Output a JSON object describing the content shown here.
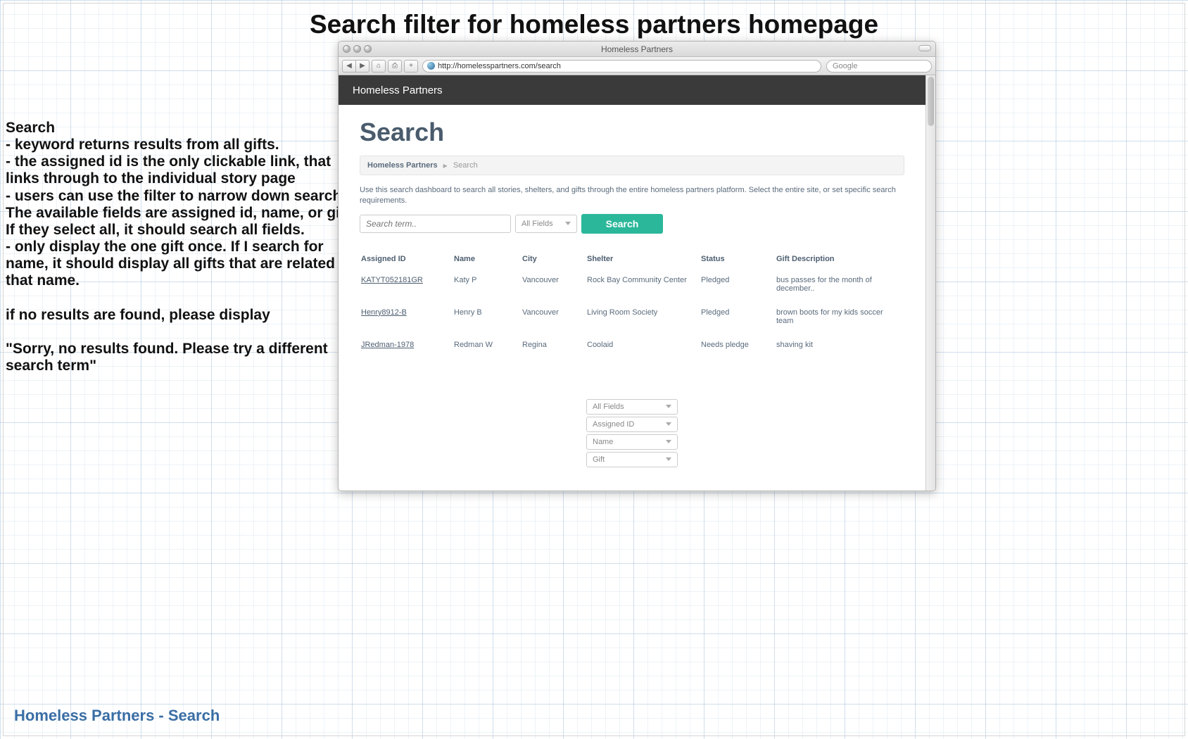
{
  "page_title": "Search filter for homeless partners homepage",
  "annotation": {
    "heading": "Search",
    "lines": [
      "- keyword returns results from all gifts.",
      "- the assigned id is the only clickable link, that links through to the individual story page",
      "- users can use the filter to narrow down search. The available fields are assigned id, name, or gift. If they select all, it should search all fields.",
      "- only display the one gift once. If I search for name, it should display all gifts that are related to that name."
    ],
    "no_results_intro": "if no results are found, please display",
    "no_results_msg": "\"Sorry, no results found. Please try a different search term\""
  },
  "footer_label": "Homeless Partners - Search",
  "browser": {
    "title": "Homeless Partners",
    "url": "http://homelesspartners.com/search",
    "search_placeholder": "Google"
  },
  "app": {
    "brand": "Homeless Partners",
    "heading": "Search",
    "breadcrumb": {
      "home": "Homeless Partners",
      "current": "Search"
    },
    "instructions": "Use this search dashboard to search all stories, shelters, and gifts through the entire homeless partners platform. Select the entire site, or set specific search requirements.",
    "search_placeholder": "Search term..",
    "filter_selected": "All Fields",
    "search_button": "Search",
    "columns": {
      "id": "Assigned ID",
      "name": "Name",
      "city": "City",
      "shelter": "Shelter",
      "status": "Status",
      "gift": "Gift Description"
    },
    "rows": [
      {
        "id": "KATYT052181GR",
        "name": "Katy P",
        "city": "Vancouver",
        "shelter": "Rock Bay Community Center",
        "status": "Pledged",
        "gift": "bus passes for the month of december.."
      },
      {
        "id": "Henry8912-B",
        "name": "Henry B",
        "city": "Vancouver",
        "shelter": "Living Room Society",
        "status": "Pledged",
        "gift": "brown boots for my kids soccer team"
      },
      {
        "id": "JRedman-1978",
        "name": "Redman W",
        "city": "Regina",
        "shelter": "Coolaid",
        "status": "Needs pledge",
        "gift": "shaving kit"
      }
    ],
    "filter_options": [
      "All Fields",
      "Assigned ID",
      "Name",
      "Gift"
    ]
  }
}
